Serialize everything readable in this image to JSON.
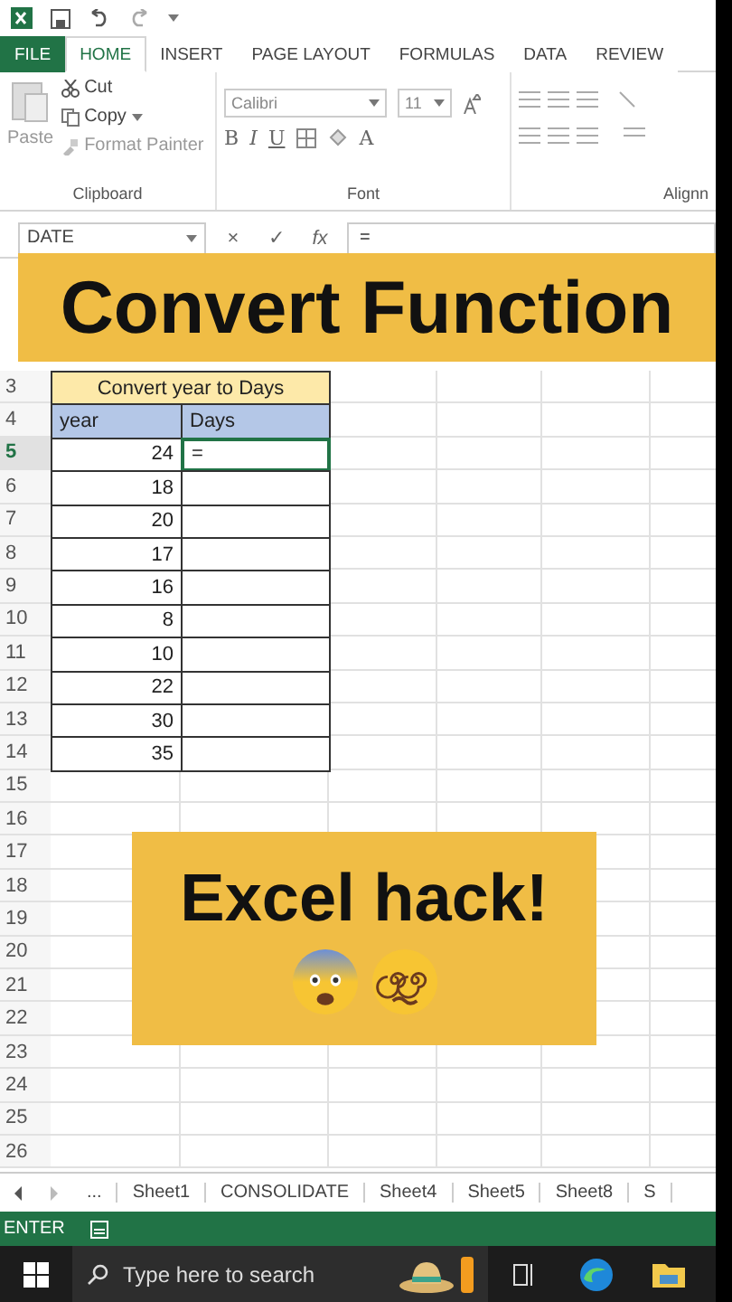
{
  "tabs": [
    {
      "label": "FILE",
      "kind": "file",
      "selected": false
    },
    {
      "label": "HOME",
      "kind": "tab",
      "selected": true
    },
    {
      "label": "INSERT",
      "kind": "tab",
      "selected": false
    },
    {
      "label": "PAGE LAYOUT",
      "kind": "tab",
      "selected": false
    },
    {
      "label": "FORMULAS",
      "kind": "tab",
      "selected": false
    },
    {
      "label": "DATA",
      "kind": "tab",
      "selected": false
    },
    {
      "label": "REVIEW",
      "kind": "tab",
      "selected": false
    }
  ],
  "clipboard": {
    "paste": "Paste",
    "cut": "Cut",
    "copy": "Copy",
    "format_painter": "Format Painter",
    "label": "Clipboard"
  },
  "font": {
    "name": "Calibri",
    "size": "11",
    "bold": "B",
    "italic": "I",
    "underline": "U",
    "color_letter": "A",
    "label": "Font"
  },
  "alignment": {
    "label": "Alignn"
  },
  "formula_bar": {
    "name_box": "DATE",
    "cancel": "×",
    "enter": "✓",
    "fx": "fx",
    "formula": "="
  },
  "banner": "Convert Function",
  "table": {
    "title": "Convert year to Days",
    "headers": [
      "year",
      "Days"
    ],
    "rows": [
      {
        "year": "24",
        "days": "=",
        "selected": true
      },
      {
        "year": "18",
        "days": "",
        "selected": false
      },
      {
        "year": "20",
        "days": "",
        "selected": false
      },
      {
        "year": "17",
        "days": "",
        "selected": false
      },
      {
        "year": "16",
        "days": "",
        "selected": false
      },
      {
        "year": "8",
        "days": "",
        "selected": false
      },
      {
        "year": "10",
        "days": "",
        "selected": false
      },
      {
        "year": "22",
        "days": "",
        "selected": false
      },
      {
        "year": "30",
        "days": "",
        "selected": false
      },
      {
        "year": "35",
        "days": "",
        "selected": false
      }
    ]
  },
  "row_numbers": [
    "3",
    "4",
    "5",
    "6",
    "7",
    "8",
    "9",
    "10",
    "11",
    "12",
    "13",
    "14",
    "15",
    "16",
    "17",
    "18",
    "19",
    "20",
    "21",
    "22",
    "23",
    "24",
    "25",
    "26"
  ],
  "overlay": "Excel hack!",
  "sheet_tabs": {
    "more": "...",
    "tabs": [
      {
        "label": "Sheet1",
        "selected": false
      },
      {
        "label": "CONSOLIDATE",
        "selected": false
      },
      {
        "label": "Sheet4",
        "selected": false
      },
      {
        "label": "Sheet5",
        "selected": false
      },
      {
        "label": "Sheet8",
        "selected": false
      },
      {
        "label": "S",
        "selected": false
      }
    ]
  },
  "status_bar": {
    "mode": "ENTER"
  },
  "taskbar": {
    "search_placeholder": "Type here to search"
  }
}
